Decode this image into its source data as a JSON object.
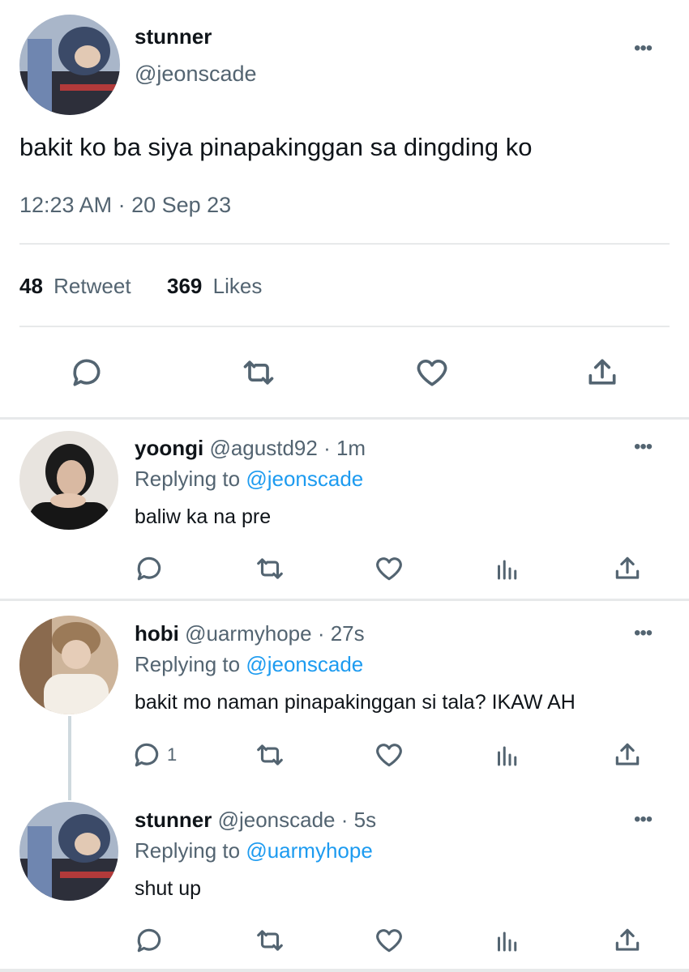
{
  "main_tweet": {
    "name": "stunner",
    "handle": "@jeonscade",
    "text": "bakit ko ba siya pinapakinggan sa dingding ko",
    "timestamp": "12:23 AM · 20 Sep 23",
    "retweet_count": "48",
    "retweet_label": "Retweet",
    "like_count": "369",
    "like_label": "Likes",
    "more_icon": "•••"
  },
  "replies": [
    {
      "name": "yoongi",
      "handle": "@agustd92",
      "time": "· 1m",
      "replying_prefix": "Replying to",
      "replying_to": "@jeonscade",
      "text": "baliw ka na pre",
      "reply_count": ""
    },
    {
      "name": "hobi",
      "handle": "@uarmyhope",
      "time": "· 27s",
      "replying_prefix": "Replying to",
      "replying_to": "@jeonscade",
      "text": "bakit mo naman pinapakinggan si tala? IKAW AH",
      "reply_count": "1"
    },
    {
      "name": "stunner",
      "handle": "@jeonscade",
      "time": "· 5s",
      "replying_prefix": "Replying to",
      "replying_to": "@uarmyhope",
      "text": "shut up",
      "reply_count": ""
    }
  ],
  "colors": {
    "link": "#1d9bf0",
    "secondary_text": "#536471",
    "divider": "#e7e9ea"
  },
  "icons": [
    "comment-icon",
    "retweet-icon",
    "heart-icon",
    "share-icon",
    "analytics-icon",
    "more-icon"
  ]
}
